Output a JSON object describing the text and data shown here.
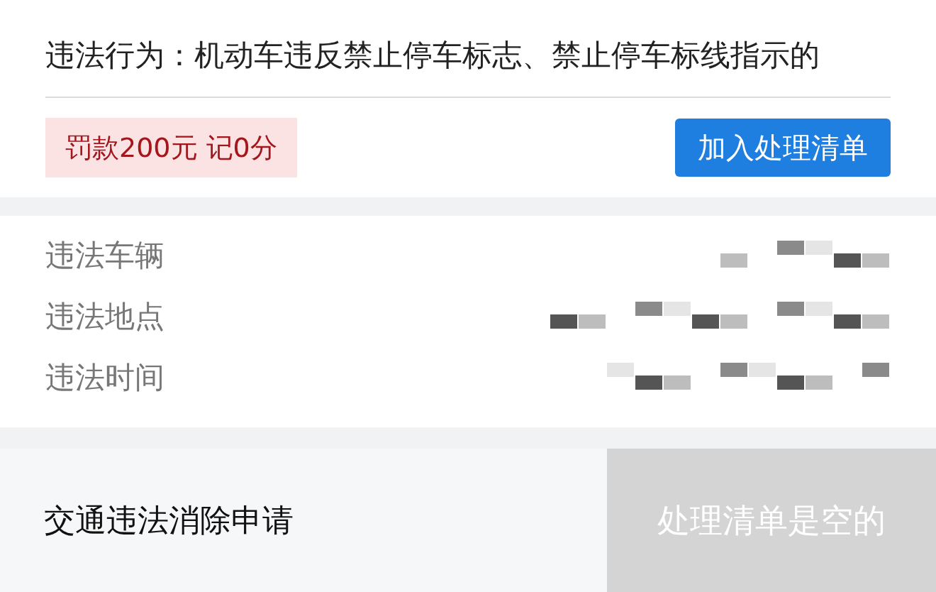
{
  "violation": {
    "text": "违法行为：机动车违反禁止停车标志、禁止停车标线指示的"
  },
  "penalty": {
    "text": "罚款200元 记0分"
  },
  "add_button": {
    "label": "加入处理清单"
  },
  "details": [
    {
      "label": "违法车辆"
    },
    {
      "label": "违法地点"
    },
    {
      "label": "违法时间"
    }
  ],
  "footer": {
    "title": "交通违法消除申请",
    "submit": {
      "label": "处理清单是空的",
      "disabled": true
    }
  }
}
